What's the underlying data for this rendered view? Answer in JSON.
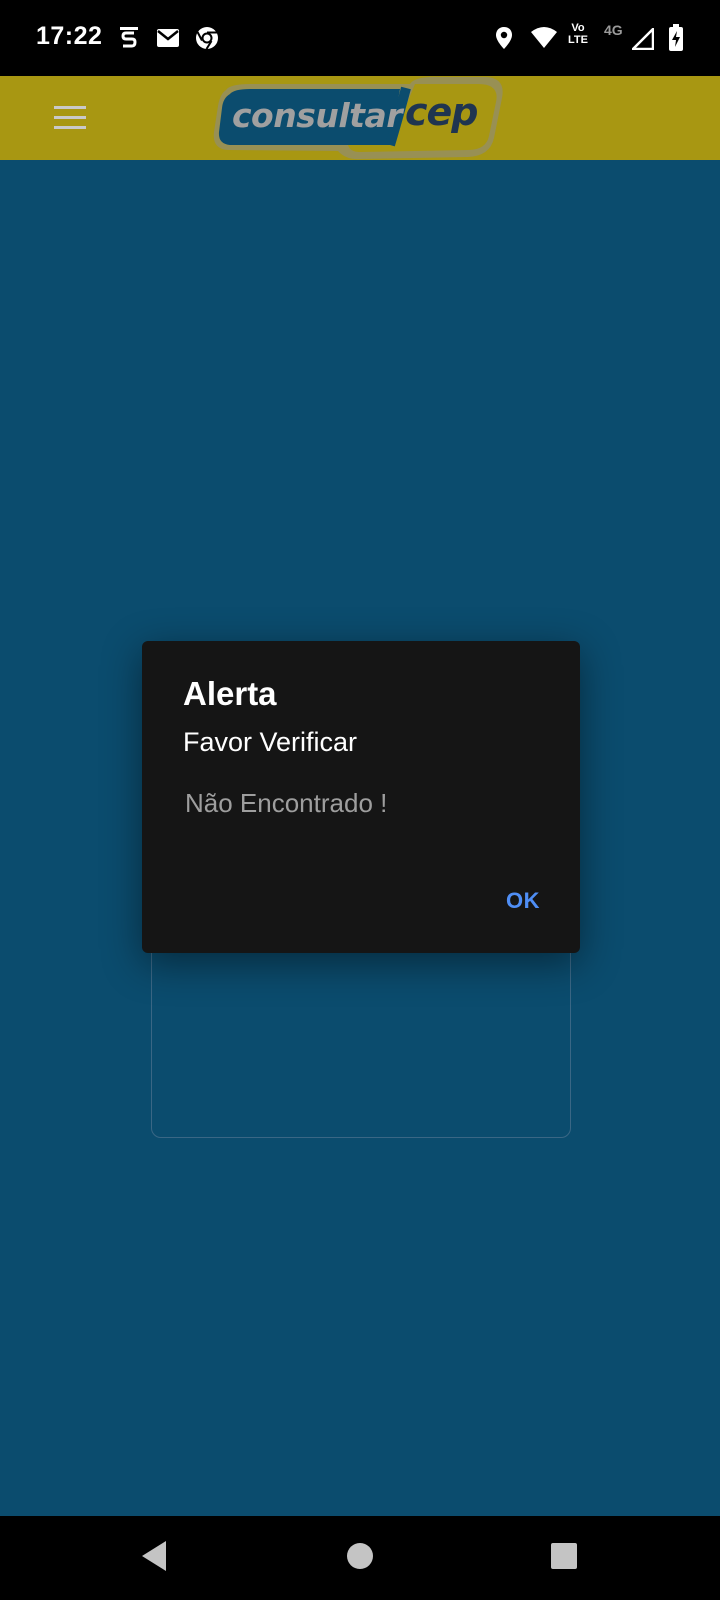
{
  "status_bar": {
    "time": "17:22",
    "icons": [
      "sim-s-icon",
      "mail-icon",
      "chrome-icon",
      "location-icon",
      "wifi-icon",
      "volte-icon",
      "network-4g-icon",
      "signal-icon",
      "battery-charging-icon"
    ],
    "volte_top": "Vo",
    "volte_bottom": "LTE",
    "network": "4G"
  },
  "app_bar": {
    "menu_icon": "hamburger-menu-icon",
    "logo_part_1": "consultar",
    "logo_part_2": "cep",
    "background": "#a89712"
  },
  "main": {
    "background": "#0b4c6e"
  },
  "dialog": {
    "title": "Alerta",
    "subtitle": "Favor Verificar",
    "message": "Não Encontrado !",
    "ok_label": "OK",
    "accent": "#4f8ef5"
  },
  "nav_bar": {
    "buttons": [
      "back-icon",
      "home-icon",
      "recents-icon"
    ]
  }
}
